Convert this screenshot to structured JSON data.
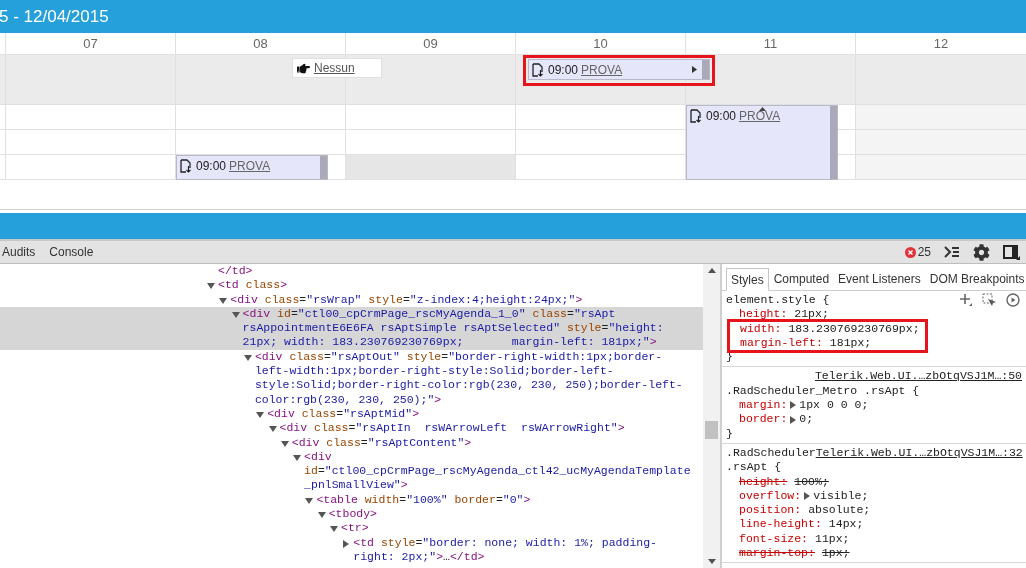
{
  "scheduler": {
    "title": "5 - 12/04/2015",
    "hours": [
      "07",
      "08",
      "09",
      "10",
      "11",
      "12"
    ],
    "rows": [
      {
        "kind": "allday",
        "cells": [
          {
            "kind": "free"
          },
          {
            "kind": "free"
          },
          {
            "kind": "free",
            "event": {
              "kind": "marker",
              "title": "Nessun"
            }
          },
          {
            "kind": "free"
          },
          {
            "kind": "free",
            "event": {
              "kind": "allday",
              "time": "09:00",
              "title": "PROVA",
              "continues": true,
              "boxed": true
            }
          },
          {
            "kind": "free"
          },
          {
            "kind": "free"
          }
        ]
      },
      {
        "kind": "slot",
        "cells": [
          {
            "kind": "free"
          },
          {
            "kind": "free"
          },
          {
            "kind": "free"
          },
          {
            "kind": "free"
          },
          {
            "kind": "free"
          },
          {
            "kind": "free",
            "event": {
              "kind": "tall",
              "time": "09:00",
              "title": "PROVA",
              "continues": false,
              "boxed": false
            }
          },
          {
            "kind": "nonwork"
          }
        ]
      },
      {
        "kind": "slot",
        "cells": [
          {
            "kind": "free"
          },
          {
            "kind": "free"
          },
          {
            "kind": "free"
          },
          {
            "kind": "free"
          },
          {
            "kind": "free"
          },
          {
            "kind": "free"
          },
          {
            "kind": "nonwork"
          }
        ]
      },
      {
        "kind": "slot",
        "cells": [
          {
            "kind": "free"
          },
          {
            "kind": "free"
          },
          {
            "kind": "free",
            "event": {
              "kind": "appointment",
              "time": "09:00",
              "title": "PROVA",
              "continues": false,
              "boxed": false
            }
          },
          {
            "kind": "blocked"
          },
          {
            "kind": "free"
          },
          {
            "kind": "free"
          },
          {
            "kind": "nonwork"
          }
        ]
      }
    ]
  },
  "devtools": {
    "panel_tabs": [
      {
        "label": "Audits",
        "selected": false
      },
      {
        "label": "Console",
        "selected": false
      }
    ],
    "error_count": "25",
    "dom_tree": [
      {
        "kind": "closing",
        "text": "</td>",
        "selected": false
      },
      {
        "kind": "element",
        "text": "<td class>",
        "expanded": true,
        "selected": false,
        "children": [
          {
            "kind": "element",
            "text": "<div class=\"rsWrap\" style=\"z-index:4;height:24px;\">",
            "expanded": true,
            "selected": false,
            "children": [
              {
                "kind": "element",
                "text": "<div id=\"ctl00_cpCrmPage_rscMyAgenda_1_0\" class=\"rsApt rsAppointmentE6E6FA rsAptSimple rsAptSelected\" style=\"height: 21px; width: 183.230769230769px;       margin-left: 181px;\">",
                "expanded": true,
                "selected": true,
                "children": [
                  {
                    "kind": "element",
                    "text": "<div class=\"rsAptOut\" style=\"border-right-width:1px;border-left-width:1px;border-right-style:Solid;border-left-style:Solid;border-right-color:rgb(230, 230, 250);border-left-color:rgb(230, 230, 250);\">",
                    "expanded": true,
                    "selected": false,
                    "children": [
                      {
                        "kind": "element",
                        "text": "<div class=\"rsAptMid\">",
                        "expanded": true,
                        "selected": false,
                        "children": [
                          {
                            "kind": "element",
                            "text": "<div class=\"rsAptIn  rsWArrowLeft  rsWArrowRight\">",
                            "expanded": true,
                            "selected": false,
                            "children": [
                              {
                                "kind": "element",
                                "text": "<div class=\"rsAptContent\">",
                                "expanded": true,
                                "selected": false,
                                "children": [
                                  {
                                    "kind": "element",
                                    "text": "<div id=\"ctl00_cpCrmPage_rscMyAgenda_ctl42_ucMyAgendaTemplate_pnlSmallView\">",
                                    "expanded": true,
                                    "selected": false,
                                    "children": [
                                      {
                                        "kind": "element",
                                        "text": "<table width=\"100%\" border=\"0\">",
                                        "expanded": true,
                                        "selected": false,
                                        "children": [
                                          {
                                            "kind": "element",
                                            "text": "<tbody>",
                                            "expanded": true,
                                            "selected": false,
                                            "children": [
                                              {
                                                "kind": "element",
                                                "text": "<tr>",
                                                "expanded": true,
                                                "selected": false,
                                                "children": [
                                                  {
                                                    "kind": "element",
                                                    "text": "<td style=\"border: none; width: 1%; padding-right: 2px;\">…</td>",
                                                    "expanded": false,
                                                    "selected": false
                                                  }
                                                ]
                                              }
                                            ]
                                          }
                                        ]
                                      }
                                    ]
                                  }
                                ]
                              }
                            ]
                          }
                        ]
                      }
                    ]
                  }
                ]
              }
            ]
          }
        ]
      }
    ],
    "style_tabs": [
      {
        "label": "Styles",
        "selected": true
      },
      {
        "label": "Computed",
        "selected": false
      },
      {
        "label": "Event Listeners",
        "selected": false
      },
      {
        "label": "DOM Breakpoints",
        "selected": false
      }
    ],
    "rules": [
      {
        "kind": "inline",
        "selector": [
          "element.style {"
        ],
        "close": "}",
        "properties": [
          {
            "name": "height:",
            "value": "21px;",
            "struck": false,
            "expandable": false,
            "boxed": false
          },
          {
            "name": "width:",
            "value": "183.230769230769px;",
            "struck": false,
            "expandable": false,
            "boxed": true
          },
          {
            "name": "margin-left:",
            "value": "181px;",
            "struck": false,
            "expandable": false,
            "boxed": true
          }
        ]
      },
      {
        "kind": "source_above",
        "source": "Telerik.Web.UI.…zbOtqVSJ1M…:50",
        "selector": [
          ".RadScheduler_Metro .rsApt {"
        ],
        "close": "}",
        "properties": [
          {
            "name": "margin:",
            "value": "1px 0 0 0;",
            "struck": false,
            "expandable": true,
            "boxed": false
          },
          {
            "name": "border:",
            "value": "0;",
            "struck": false,
            "expandable": true,
            "boxed": false
          }
        ]
      },
      {
        "kind": "source_beside",
        "source": "Telerik.Web.UI.…zbOtqVSJ1M…:32",
        "selector": [
          ".RadScheduler",
          ".rsApt {"
        ],
        "properties": [
          {
            "name": "height:",
            "value": "100%;",
            "struck": true,
            "expandable": false,
            "boxed": false
          },
          {
            "name": "overflow:",
            "value": "visible;",
            "struck": false,
            "expandable": true,
            "boxed": false
          },
          {
            "name": "position:",
            "value": "absolute;",
            "struck": false,
            "expandable": false,
            "boxed": false
          },
          {
            "name": "line-height:",
            "value": "14px;",
            "struck": false,
            "expandable": false,
            "boxed": false
          },
          {
            "name": "font-size:",
            "value": "11px;",
            "struck": false,
            "expandable": false,
            "boxed": false
          },
          {
            "name": "margin-top:",
            "value": "1px;",
            "struck": true,
            "expandable": false,
            "boxed": false
          }
        ]
      }
    ]
  }
}
